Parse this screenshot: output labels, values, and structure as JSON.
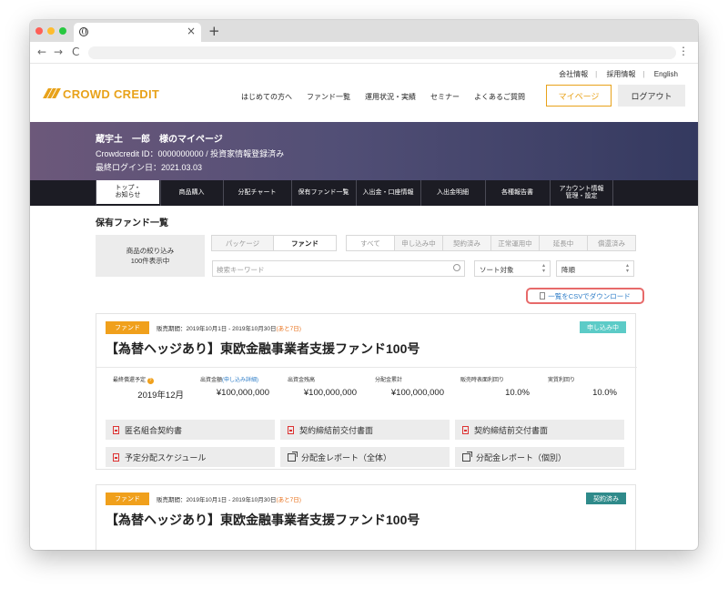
{
  "browser": {
    "close_tab": "×",
    "new_tab": "+",
    "back": "←",
    "forward": "→",
    "reload": "C",
    "menu": "⋮"
  },
  "header": {
    "utility": [
      "会社情報",
      "採用情報",
      "English"
    ],
    "logo": "CROWD CREDIT",
    "nav": [
      "はじめての方へ",
      "ファンド一覧",
      "運用状況・実績",
      "セミナー",
      "よくあるご質問"
    ],
    "mypage": "マイページ",
    "logout": "ログアウト"
  },
  "banner": {
    "name": "蔵宇土　一郎　様のマイページ",
    "id_line": "Crowdcredit ID：0000000000 / 投資家情報登録済み",
    "login_line": "最終ログイン日：2021.03.03"
  },
  "subnav": {
    "top1": "トップ・",
    "top2": "お知らせ",
    "items": [
      "商品購入",
      "分配チャート",
      "保有ファンド一覧",
      "入出金・口座情報",
      "入出金明細",
      "各種報告書"
    ],
    "account1": "アカウント情報",
    "account2": "管理・設定"
  },
  "main": {
    "title": "保有ファンド一覧",
    "filter_line1": "商品の絞り込み",
    "filter_line2": "100件表示中",
    "type_tabs": [
      "パッケージ",
      "ファンド"
    ],
    "status_tabs": [
      "すべて",
      "申し込み中",
      "契約済み",
      "正常運用中",
      "延長中",
      "償還済み"
    ],
    "search_placeholder": "検索キーワード",
    "sort": "ソート対象",
    "order": "降順",
    "csv": "一覧をCSVでダウンロード"
  },
  "funds": [
    {
      "tag": "ファンド",
      "period": "販売期間：2019年10月1日 - 2019年10月30日",
      "remain": "(あと7日)",
      "status": "申し込み中",
      "status_color": "#5ccbc7",
      "title": "【為替ヘッジあり】東欧金融事業者支援ファンド100号",
      "labels": [
        "最終償還予定",
        "出資金額",
        "(申し込み詳細)",
        "出資金残高",
        "分配金累計",
        "販売時表面利回り",
        "実質利回り"
      ],
      "values": [
        "2019年12月",
        "¥100,000,000",
        "¥100,000,000",
        "¥100,000,000",
        "10.0%",
        "10.0%"
      ],
      "docs": [
        "匿名組合契約書",
        "契約締結前交付書面",
        "契約締結前交付書面",
        "予定分配スケジュール",
        "分配金レポート（全体）",
        "分配金レポート（個別）"
      ]
    },
    {
      "tag": "ファンド",
      "period": "販売期間：2019年10月1日 - 2019年10月30日",
      "remain": "(あと7日)",
      "status": "契約済み",
      "status_color": "#2f8a8a",
      "title": "【為替ヘッジあり】東欧金融事業者支援ファンド100号"
    }
  ],
  "colors": {
    "brand": "#e8a21a",
    "csv_highlight": "#e76a6a",
    "link": "#2f7ec8"
  }
}
